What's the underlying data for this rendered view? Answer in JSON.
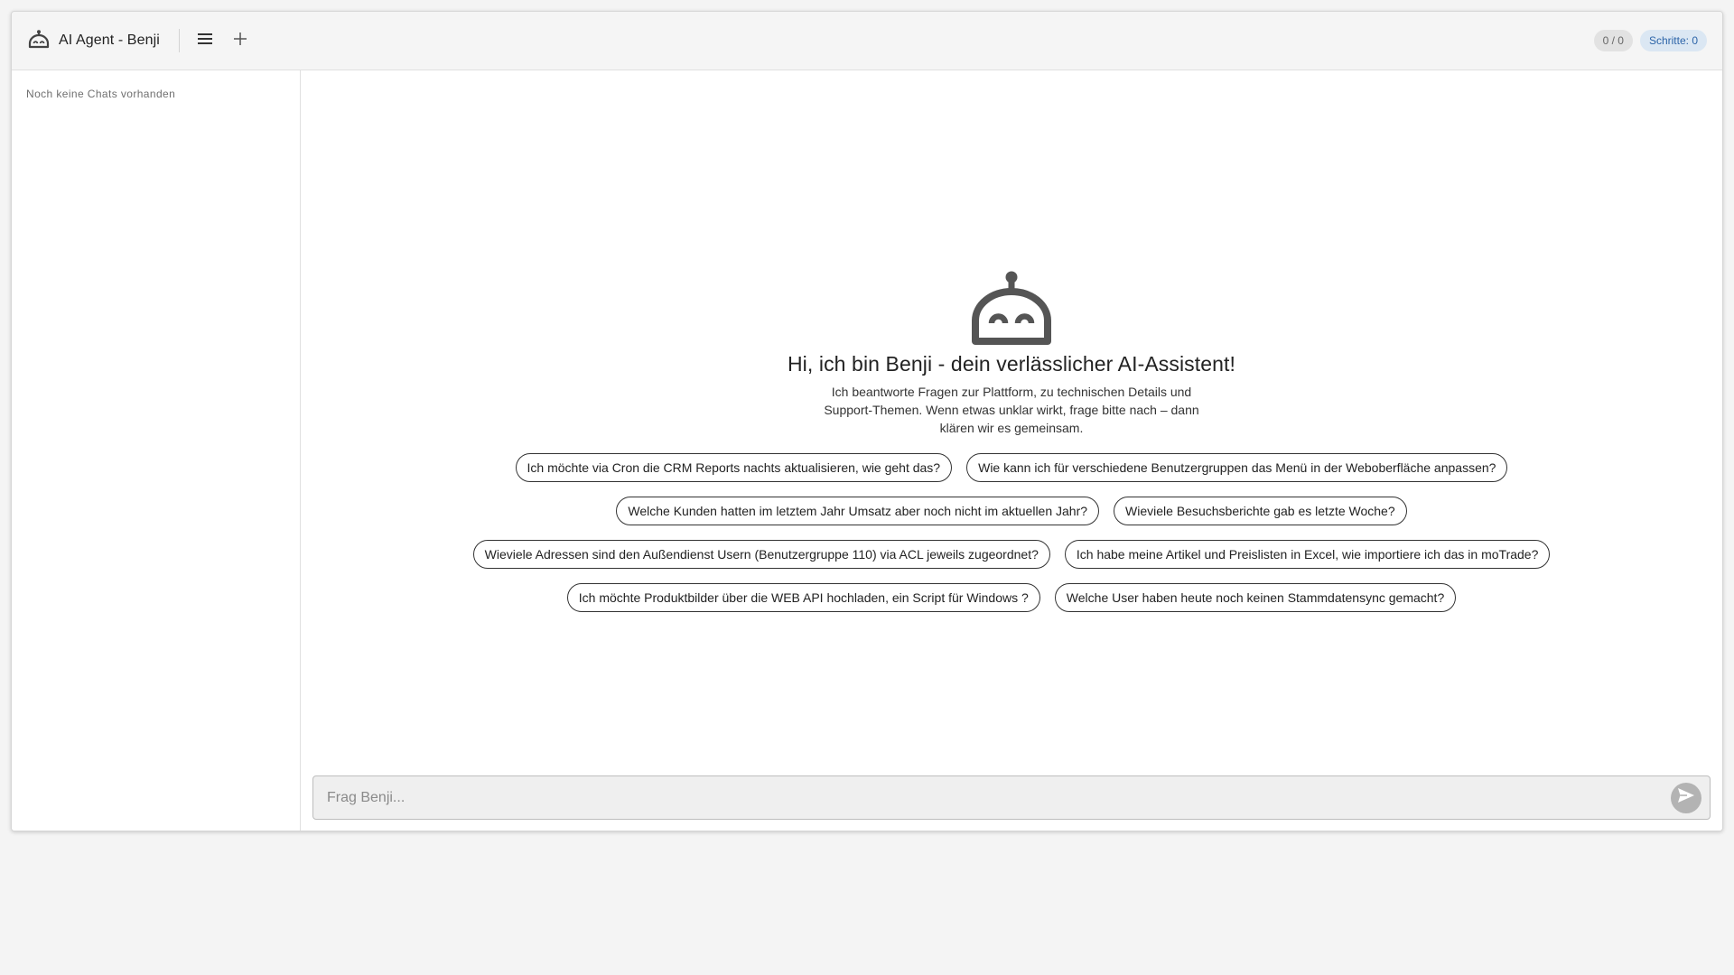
{
  "app": {
    "title": "AI Agent - Benji"
  },
  "header": {
    "menu_icon": "menu-icon",
    "new_chat_icon": "plus-icon",
    "counter": "0 / 0",
    "steps": "Schritte: 0"
  },
  "sidebar": {
    "empty_text": "Noch keine Chats vorhanden"
  },
  "welcome": {
    "icon": "robot-icon",
    "title": "Hi, ich bin Benji - dein verlässlicher AI-Assistent!",
    "subtitle": "Ich beantworte Fragen zur Plattform, zu technischen Details und Support-Themen. Wenn etwas unklar wirkt, frage bitte nach – dann klären wir es gemeinsam.",
    "suggestions": [
      "Ich möchte via Cron die CRM Reports nachts aktualisieren, wie geht das?",
      "Wie kann ich für verschiedene Benutzergruppen das Menü in der Weboberfläche anpassen?",
      "Welche Kunden hatten im letztem Jahr Umsatz aber noch nicht im aktuellen Jahr?",
      "Wieviele Besuchsberichte gab es letzte Woche?",
      "Wieviele Adressen sind den Außendienst Usern (Benutzergruppe 110) via ACL jeweils zugeordnet?",
      "Ich habe meine Artikel und Preislisten in Excel, wie importiere ich das in moTrade?",
      "Ich möchte Produktbilder über die WEB API hochladen, ein Script für Windows ?",
      "Welche User haben heute noch keinen Stammdatensync gemacht?"
    ]
  },
  "composer": {
    "placeholder": "Frag Benji...",
    "value": "",
    "send_icon": "send-icon"
  },
  "colors": {
    "icon": "#555555",
    "steps_chip_bg": "#dbe7f3",
    "steps_chip_text": "#2c64a8",
    "send_button": "#b3b3b3"
  }
}
